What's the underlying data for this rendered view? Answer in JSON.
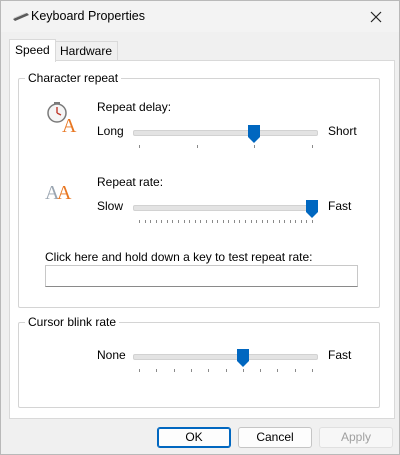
{
  "window": {
    "title": "Keyboard Properties"
  },
  "tabs": [
    {
      "label": "Speed",
      "active": true
    },
    {
      "label": "Hardware",
      "active": false
    }
  ],
  "character_repeat": {
    "legend": "Character repeat",
    "repeat_delay": {
      "label": "Repeat delay:",
      "min_label": "Long",
      "max_label": "Short",
      "tick_count": 4,
      "value": 2
    },
    "repeat_rate": {
      "label": "Repeat rate:",
      "min_label": "Slow",
      "max_label": "Fast",
      "tick_count": 32,
      "value": 31
    },
    "test_label": "Click here and hold down a key to test repeat rate:",
    "test_value": ""
  },
  "cursor_blink": {
    "legend": "Cursor blink rate",
    "min_label": "None",
    "max_label": "Fast",
    "tick_count": 11,
    "value": 6
  },
  "buttons": {
    "ok": "OK",
    "cancel": "Cancel",
    "apply": "Apply"
  },
  "colors": {
    "accent": "#0067c0",
    "icon_orange": "#e87722",
    "icon_gray": "#9aa5b1"
  }
}
